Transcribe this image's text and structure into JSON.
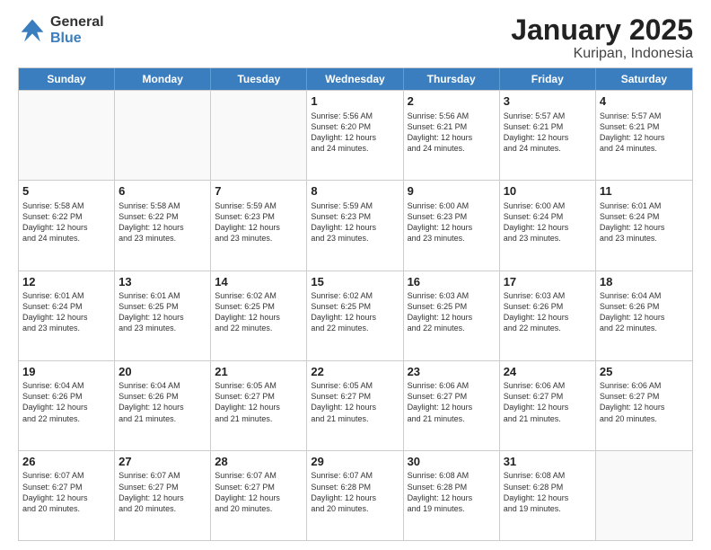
{
  "logo": {
    "general": "General",
    "blue": "Blue"
  },
  "title": "January 2025",
  "subtitle": "Kuripan, Indonesia",
  "days": [
    "Sunday",
    "Monday",
    "Tuesday",
    "Wednesday",
    "Thursday",
    "Friday",
    "Saturday"
  ],
  "weeks": [
    [
      {
        "day": "",
        "info": ""
      },
      {
        "day": "",
        "info": ""
      },
      {
        "day": "",
        "info": ""
      },
      {
        "day": "1",
        "info": "Sunrise: 5:56 AM\nSunset: 6:20 PM\nDaylight: 12 hours\nand 24 minutes."
      },
      {
        "day": "2",
        "info": "Sunrise: 5:56 AM\nSunset: 6:21 PM\nDaylight: 12 hours\nand 24 minutes."
      },
      {
        "day": "3",
        "info": "Sunrise: 5:57 AM\nSunset: 6:21 PM\nDaylight: 12 hours\nand 24 minutes."
      },
      {
        "day": "4",
        "info": "Sunrise: 5:57 AM\nSunset: 6:21 PM\nDaylight: 12 hours\nand 24 minutes."
      }
    ],
    [
      {
        "day": "5",
        "info": "Sunrise: 5:58 AM\nSunset: 6:22 PM\nDaylight: 12 hours\nand 24 minutes."
      },
      {
        "day": "6",
        "info": "Sunrise: 5:58 AM\nSunset: 6:22 PM\nDaylight: 12 hours\nand 23 minutes."
      },
      {
        "day": "7",
        "info": "Sunrise: 5:59 AM\nSunset: 6:23 PM\nDaylight: 12 hours\nand 23 minutes."
      },
      {
        "day": "8",
        "info": "Sunrise: 5:59 AM\nSunset: 6:23 PM\nDaylight: 12 hours\nand 23 minutes."
      },
      {
        "day": "9",
        "info": "Sunrise: 6:00 AM\nSunset: 6:23 PM\nDaylight: 12 hours\nand 23 minutes."
      },
      {
        "day": "10",
        "info": "Sunrise: 6:00 AM\nSunset: 6:24 PM\nDaylight: 12 hours\nand 23 minutes."
      },
      {
        "day": "11",
        "info": "Sunrise: 6:01 AM\nSunset: 6:24 PM\nDaylight: 12 hours\nand 23 minutes."
      }
    ],
    [
      {
        "day": "12",
        "info": "Sunrise: 6:01 AM\nSunset: 6:24 PM\nDaylight: 12 hours\nand 23 minutes."
      },
      {
        "day": "13",
        "info": "Sunrise: 6:01 AM\nSunset: 6:25 PM\nDaylight: 12 hours\nand 23 minutes."
      },
      {
        "day": "14",
        "info": "Sunrise: 6:02 AM\nSunset: 6:25 PM\nDaylight: 12 hours\nand 22 minutes."
      },
      {
        "day": "15",
        "info": "Sunrise: 6:02 AM\nSunset: 6:25 PM\nDaylight: 12 hours\nand 22 minutes."
      },
      {
        "day": "16",
        "info": "Sunrise: 6:03 AM\nSunset: 6:25 PM\nDaylight: 12 hours\nand 22 minutes."
      },
      {
        "day": "17",
        "info": "Sunrise: 6:03 AM\nSunset: 6:26 PM\nDaylight: 12 hours\nand 22 minutes."
      },
      {
        "day": "18",
        "info": "Sunrise: 6:04 AM\nSunset: 6:26 PM\nDaylight: 12 hours\nand 22 minutes."
      }
    ],
    [
      {
        "day": "19",
        "info": "Sunrise: 6:04 AM\nSunset: 6:26 PM\nDaylight: 12 hours\nand 22 minutes."
      },
      {
        "day": "20",
        "info": "Sunrise: 6:04 AM\nSunset: 6:26 PM\nDaylight: 12 hours\nand 21 minutes."
      },
      {
        "day": "21",
        "info": "Sunrise: 6:05 AM\nSunset: 6:27 PM\nDaylight: 12 hours\nand 21 minutes."
      },
      {
        "day": "22",
        "info": "Sunrise: 6:05 AM\nSunset: 6:27 PM\nDaylight: 12 hours\nand 21 minutes."
      },
      {
        "day": "23",
        "info": "Sunrise: 6:06 AM\nSunset: 6:27 PM\nDaylight: 12 hours\nand 21 minutes."
      },
      {
        "day": "24",
        "info": "Sunrise: 6:06 AM\nSunset: 6:27 PM\nDaylight: 12 hours\nand 21 minutes."
      },
      {
        "day": "25",
        "info": "Sunrise: 6:06 AM\nSunset: 6:27 PM\nDaylight: 12 hours\nand 20 minutes."
      }
    ],
    [
      {
        "day": "26",
        "info": "Sunrise: 6:07 AM\nSunset: 6:27 PM\nDaylight: 12 hours\nand 20 minutes."
      },
      {
        "day": "27",
        "info": "Sunrise: 6:07 AM\nSunset: 6:27 PM\nDaylight: 12 hours\nand 20 minutes."
      },
      {
        "day": "28",
        "info": "Sunrise: 6:07 AM\nSunset: 6:27 PM\nDaylight: 12 hours\nand 20 minutes."
      },
      {
        "day": "29",
        "info": "Sunrise: 6:07 AM\nSunset: 6:28 PM\nDaylight: 12 hours\nand 20 minutes."
      },
      {
        "day": "30",
        "info": "Sunrise: 6:08 AM\nSunset: 6:28 PM\nDaylight: 12 hours\nand 19 minutes."
      },
      {
        "day": "31",
        "info": "Sunrise: 6:08 AM\nSunset: 6:28 PM\nDaylight: 12 hours\nand 19 minutes."
      },
      {
        "day": "",
        "info": ""
      }
    ]
  ]
}
